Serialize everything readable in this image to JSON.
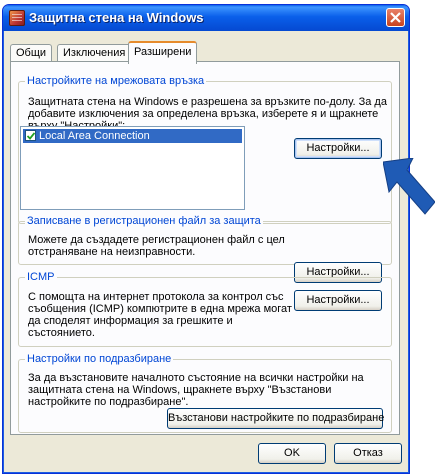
{
  "window": {
    "title": "Защитна стена на Windows"
  },
  "tabs": [
    "Общи",
    "Изключения",
    "Разширени"
  ],
  "network": {
    "title": "Настройките на мрежовата връзка",
    "desc_lines": [
      "Защитната стена на Windows е разрешена за връзките по-долу. За да",
      "добавите изключения за определена връзка, изберете я и щракнете",
      "върху \"Настройки\":"
    ],
    "connection_label": "Local Area Connection",
    "connection_checked": true,
    "settings_button": "Настройки..."
  },
  "logging": {
    "title": "Записване в регистрационен файл за защита",
    "desc_lines": [
      "Можете да създадете регистрационен файл с цел",
      "отстраняване на неизправности."
    ],
    "settings_button": "Настройки..."
  },
  "icmp": {
    "title": "ICMP",
    "desc_lines": [
      "С помощта на интернет протокола за контрол със",
      "съобщения (ICMP) компютрите в една мрежа могат",
      "да споделят информация за грешките и",
      "състоянието."
    ],
    "settings_button": "Настройки..."
  },
  "defaults": {
    "title": "Настройки по подразбиране",
    "desc_lines": [
      "За да възстановите началното състояние на всички настройки на",
      "защитната стена на Windows, щракнете върху \"Възстанови",
      "настройките по подразбиране\"."
    ],
    "restore_button": "Възстанови настройките по подразбиране"
  },
  "footer": {
    "ok_label": "OK",
    "cancel_label": "Отказ"
  },
  "colors": {
    "titlebar": "#0a5fea",
    "accent_arrow": "#1f5bb5",
    "group_title": "#0046d5",
    "selection": "#316ac5"
  },
  "icons": {
    "app": "firewall-icon",
    "close": "close-icon",
    "pointer": "arrow-pointer-icon",
    "check": "checkmark-icon"
  }
}
